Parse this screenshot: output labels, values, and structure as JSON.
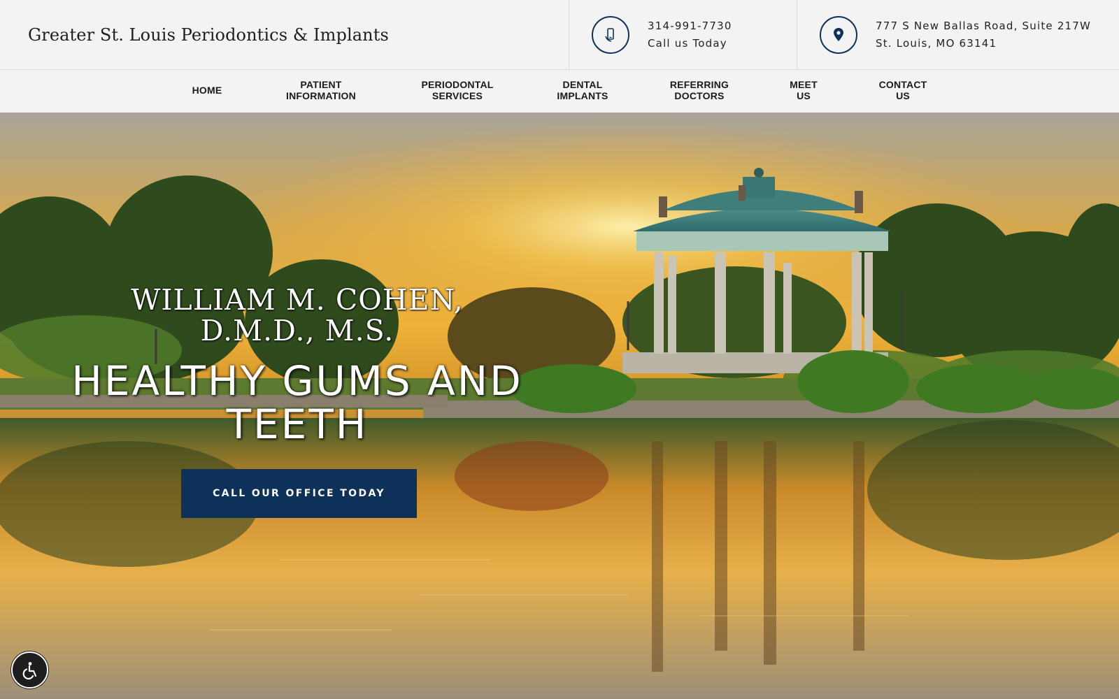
{
  "header": {
    "brand": "Greater St. Louis Periodontics & Implants",
    "phone": {
      "icon": "phone-icon",
      "number": "314-991-7730",
      "caption": "Call us Today"
    },
    "address": {
      "icon": "map-pin-icon",
      "line1": "777 S New Ballas Road, Suite 217W",
      "line2": "St. Louis, MO 63141"
    }
  },
  "nav": {
    "items": [
      "HOME",
      "PATIENT\nINFORMATION",
      "PERIODONTAL\nSERVICES",
      "DENTAL\nIMPLANTS",
      "REFERRING\nDOCTORS",
      "MEET\nUS",
      "CONTACT\nUS"
    ]
  },
  "hero": {
    "name": "WILLIAM M. COHEN, D.M.D., M.S.",
    "tagline": "HEALTHY GUMS AND TEETH",
    "cta": "CALL OUR OFFICE TODAY"
  },
  "accessibility": {
    "icon": "accessibility-icon"
  },
  "colors": {
    "accent": "#0d3159",
    "header_bg": "#f3f3f3"
  }
}
